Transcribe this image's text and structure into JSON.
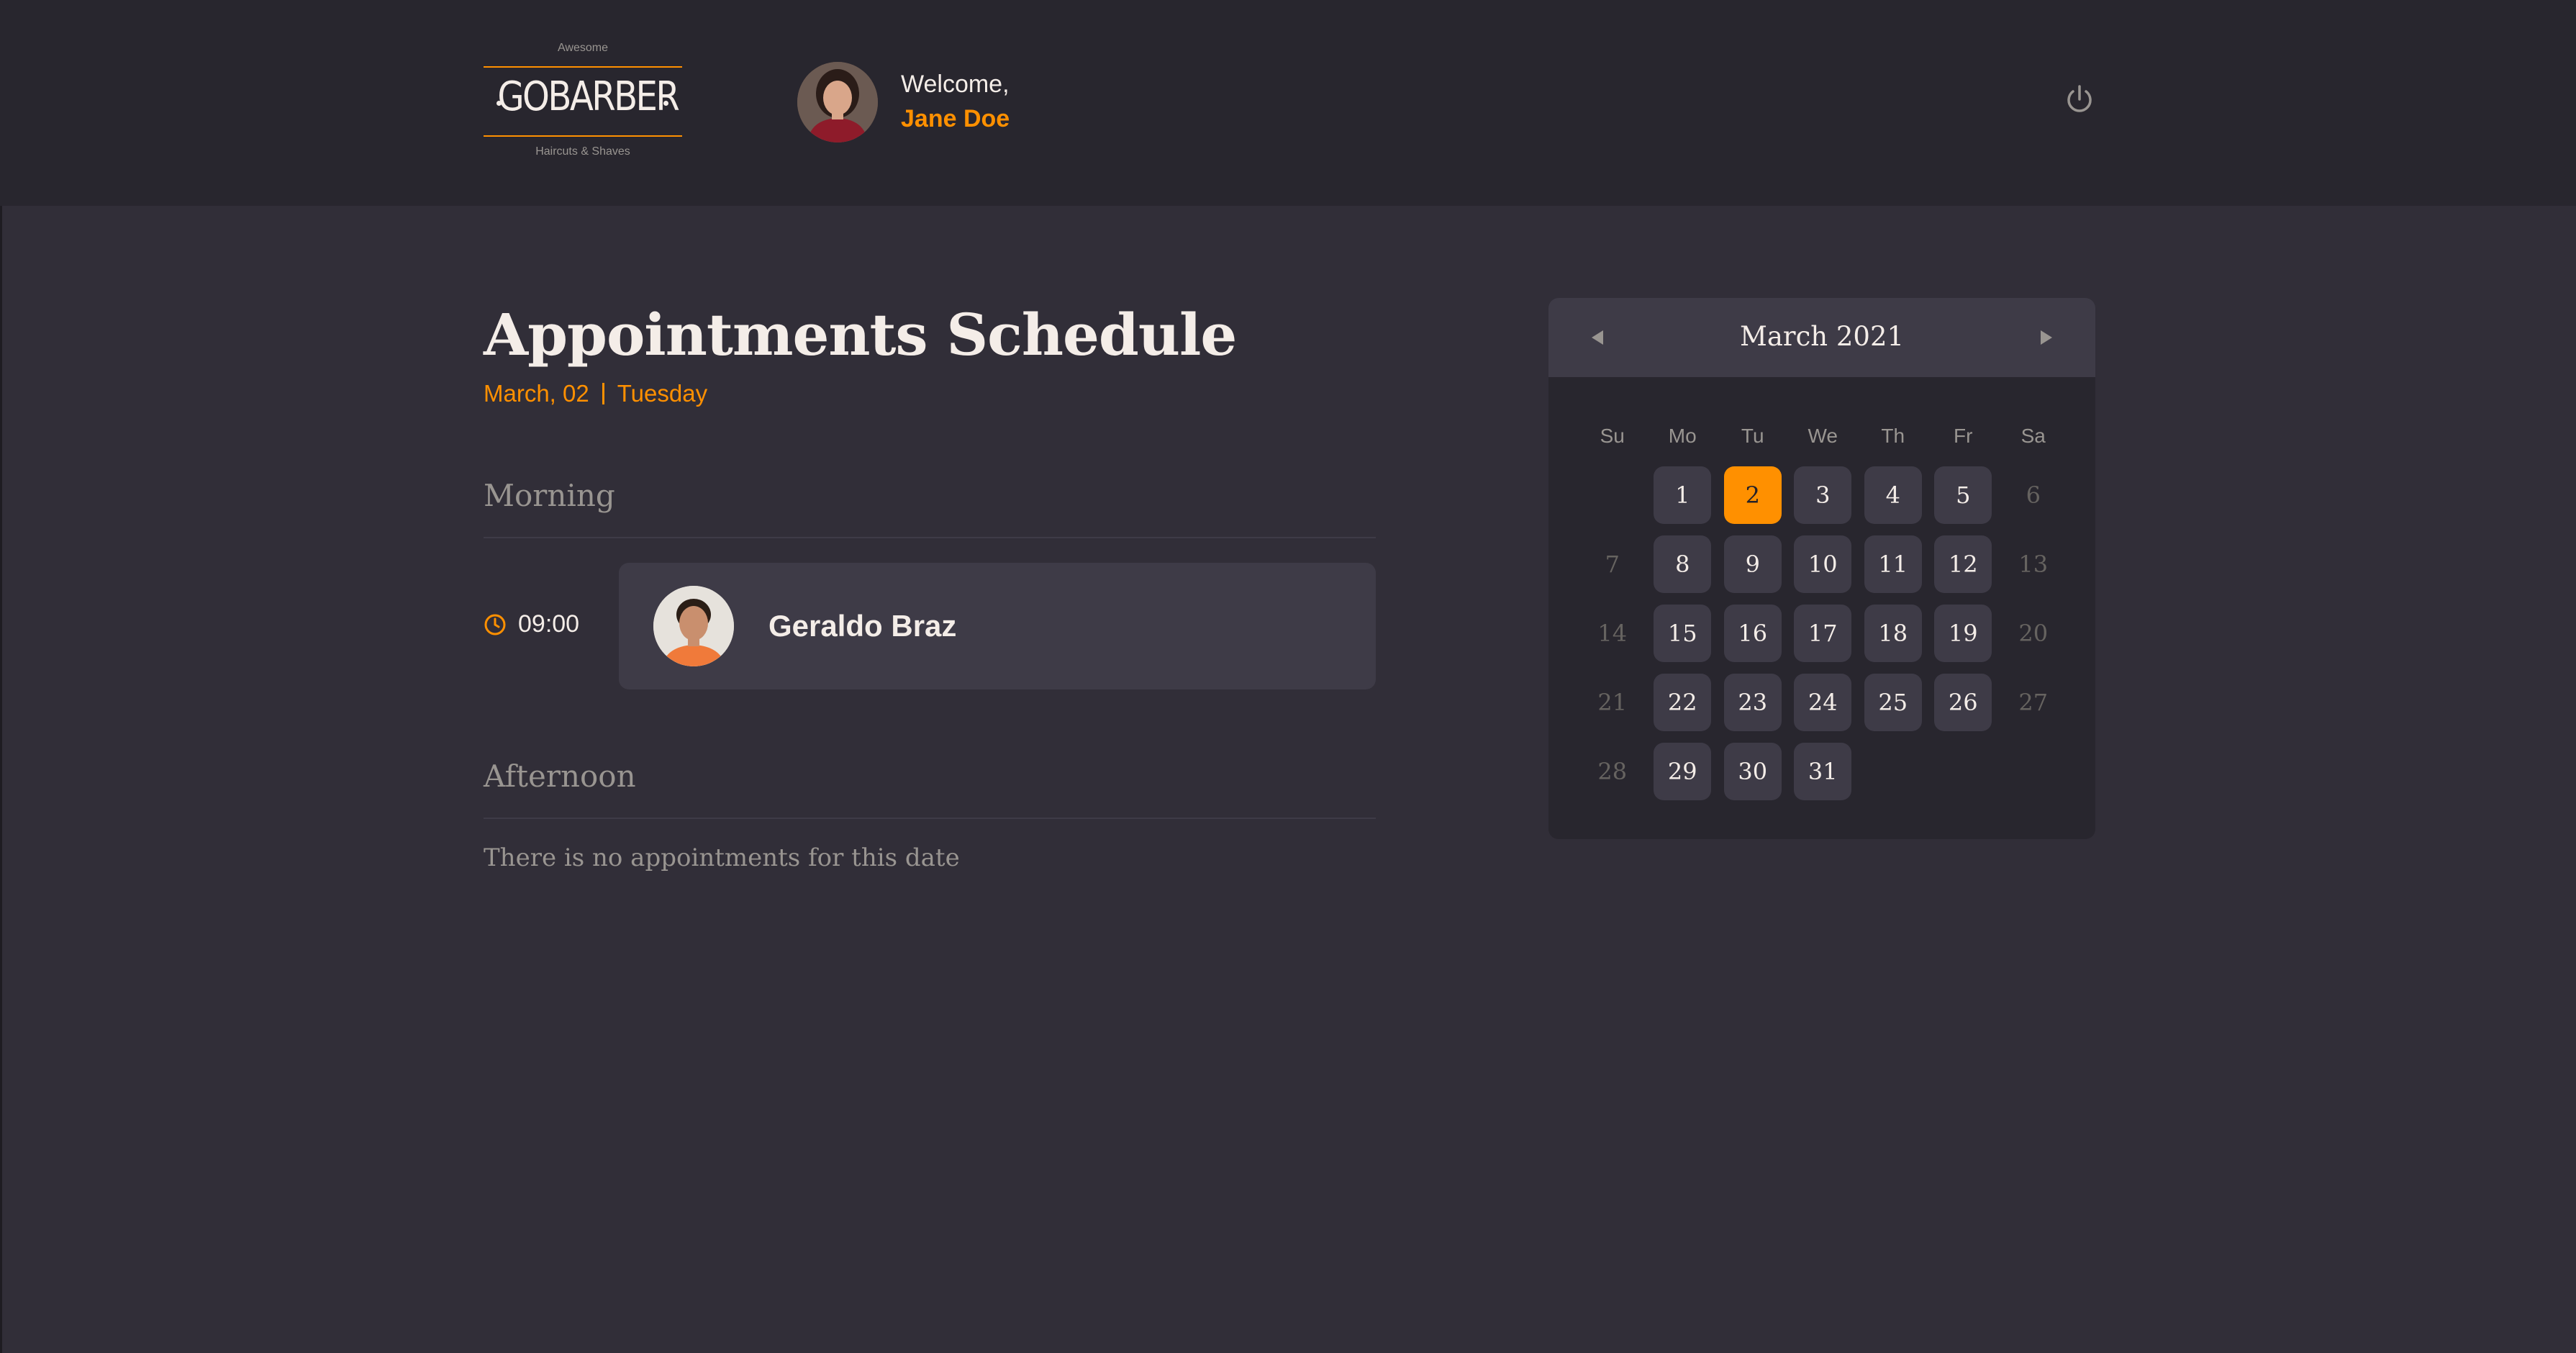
{
  "header": {
    "logo": {
      "top": "Awesome",
      "main": "GOBARBER",
      "bottom": "Haircuts & Shaves"
    },
    "welcome": "Welcome,",
    "user_name": "Jane Doe",
    "power_icon": "power-icon"
  },
  "schedule": {
    "title": "Appointments Schedule",
    "date": "March, 02",
    "weekday": "Tuesday",
    "morning": {
      "title": "Morning",
      "appointments": [
        {
          "time": "09:00",
          "name": "Geraldo Braz"
        }
      ]
    },
    "afternoon": {
      "title": "Afternoon",
      "empty_text": "There is no appointments for this date"
    }
  },
  "calendar": {
    "month_label": "March 2021",
    "prev_icon": "chevron-left-icon",
    "next_icon": "chevron-right-icon",
    "weekdays": [
      "Su",
      "Mo",
      "Tu",
      "We",
      "Th",
      "Fr",
      "Sa"
    ],
    "selected_day": 2,
    "disabled_days": [
      6,
      7,
      13,
      14,
      20,
      21,
      27,
      28
    ],
    "days": [
      "1",
      "2",
      "3",
      "4",
      "5",
      "6",
      "7",
      "8",
      "9",
      "10",
      "11",
      "12",
      "13",
      "14",
      "15",
      "16",
      "17",
      "18",
      "19",
      "20",
      "21",
      "22",
      "23",
      "24",
      "25",
      "26",
      "27",
      "28",
      "29",
      "30",
      "31"
    ]
  },
  "colors": {
    "accent": "#ff9000",
    "background": "#312e38",
    "header": "#28262e",
    "card": "#3e3b47",
    "text": "#f4ede8",
    "muted": "#999591"
  }
}
